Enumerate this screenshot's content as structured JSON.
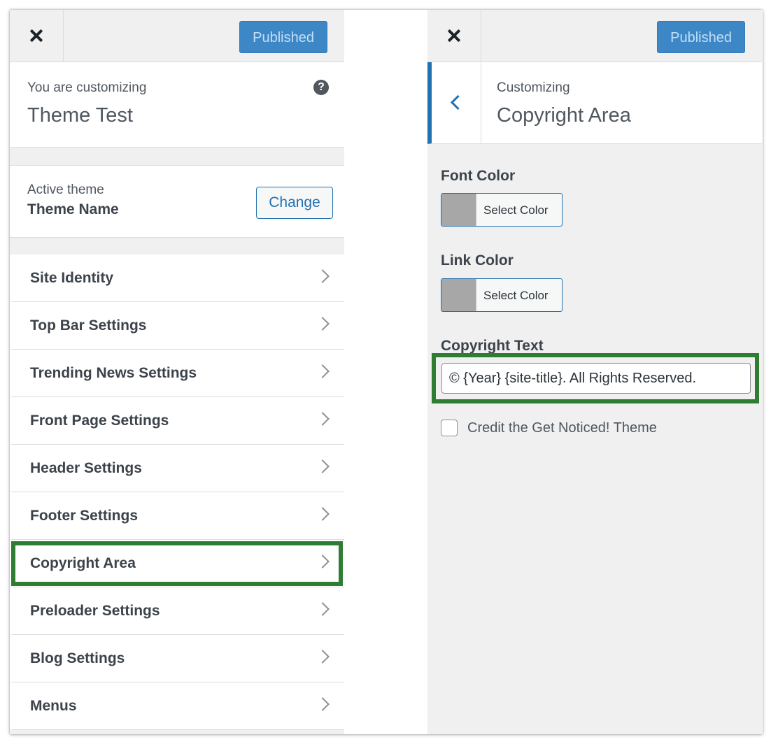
{
  "left_panel": {
    "close_icon": "close-icon",
    "publish_label": "Published",
    "customizing_label": "You are customizing",
    "site_title": "Theme Test",
    "help_icon": "help-icon",
    "help_glyph": "?",
    "active_theme_label": "Active theme",
    "theme_name": "Theme Name",
    "change_label": "Change",
    "menu_items": [
      {
        "label": "Site Identity"
      },
      {
        "label": "Top Bar Settings"
      },
      {
        "label": "Trending News Settings"
      },
      {
        "label": "Front Page Settings"
      },
      {
        "label": "Header Settings"
      },
      {
        "label": "Footer Settings"
      },
      {
        "label": "Copyright Area"
      },
      {
        "label": "Preloader Settings"
      },
      {
        "label": "Blog Settings"
      },
      {
        "label": "Menus"
      }
    ]
  },
  "right_panel": {
    "close_icon": "close-icon",
    "publish_label": "Published",
    "back_icon": "chevron-left-icon",
    "customizing_label": "Customizing",
    "section_title": "Copyright Area",
    "font_color_label": "Font Color",
    "font_color_button": "Select Color",
    "link_color_label": "Link Color",
    "link_color_button": "Select Color",
    "copyright_text_label": "Copyright Text",
    "copyright_text_value": "© {Year} {site-title}. All Rights Reserved.",
    "credit_label": "Credit the Get Noticed! Theme"
  },
  "colors": {
    "accent": "#2271b1",
    "publish": "#3582c4",
    "highlight": "#2e7d32",
    "swatch": "#a7a7a7"
  }
}
